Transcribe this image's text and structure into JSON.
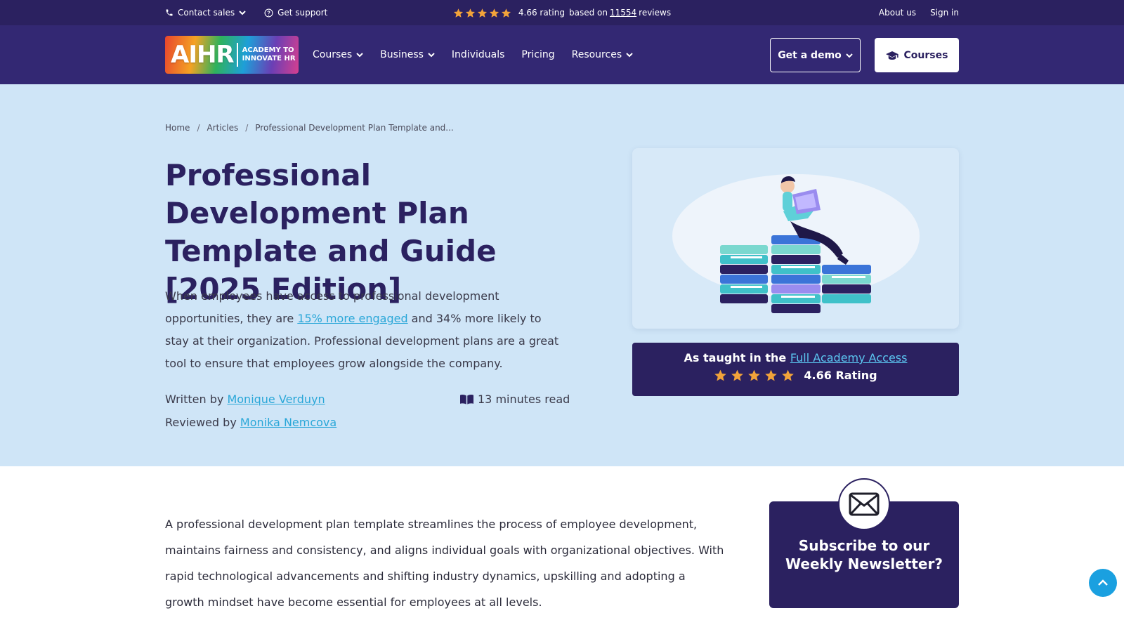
{
  "topbar": {
    "contact_sales": "Contact sales",
    "get_support": "Get support",
    "rating_value": "4.66 rating",
    "rating_based_on": "based on",
    "rating_count": "11554",
    "rating_reviews": "reviews",
    "about_us": "About us",
    "sign_in": "Sign in"
  },
  "nav": {
    "logo_word": "AIHR",
    "logo_tag_line1": "ACADEMY TO",
    "logo_tag_line2": "INNOVATE HR",
    "items": [
      {
        "label": "Courses"
      },
      {
        "label": "Business"
      },
      {
        "label": "Individuals"
      },
      {
        "label": "Pricing"
      },
      {
        "label": "Resources"
      }
    ],
    "demo_label": "Get a demo",
    "courses_label": "Courses"
  },
  "breadcrumb": {
    "home": "Home",
    "articles": "Articles",
    "current": "Professional Development Plan Template and..."
  },
  "hero": {
    "title": "Professional Development Plan Template and Guide [2025 Edition]",
    "lead_part1": "When employees have access to professional development opportunities, they are ",
    "lead_link": "15% more engaged",
    "lead_part2": " and 34% more likely to stay at their organization. Professional development plans are a great tool to ensure that employees grow alongside the company.",
    "written_by_label": "Written by ",
    "author": "Monique Verduyn",
    "reviewed_by_label": "Reviewed by ",
    "reviewer": "Monika Nemcova",
    "read_time": "13 minutes read"
  },
  "taught": {
    "prefix": "As taught in the ",
    "link": "Full Academy Access",
    "rating": "4.66 Rating"
  },
  "body": {
    "intro": "A professional development plan template streamlines the process of employee development, maintains fairness and consistency, and aligns individual goals with organizational objectives. With rapid technological advancements and shifting industry dynamics, upskilling and adopting a growth mindset have become essential for employees at all levels."
  },
  "newsletter": {
    "title": "Subscribe to our Weekly Newsletter?"
  },
  "colors": {
    "brand_dark": "#2b2160",
    "nav": "#332873",
    "hero_bg": "#cfe5f7",
    "link": "#2aa7d8",
    "star": "#f2a33a",
    "scroll_top": "#1aa0e0"
  }
}
